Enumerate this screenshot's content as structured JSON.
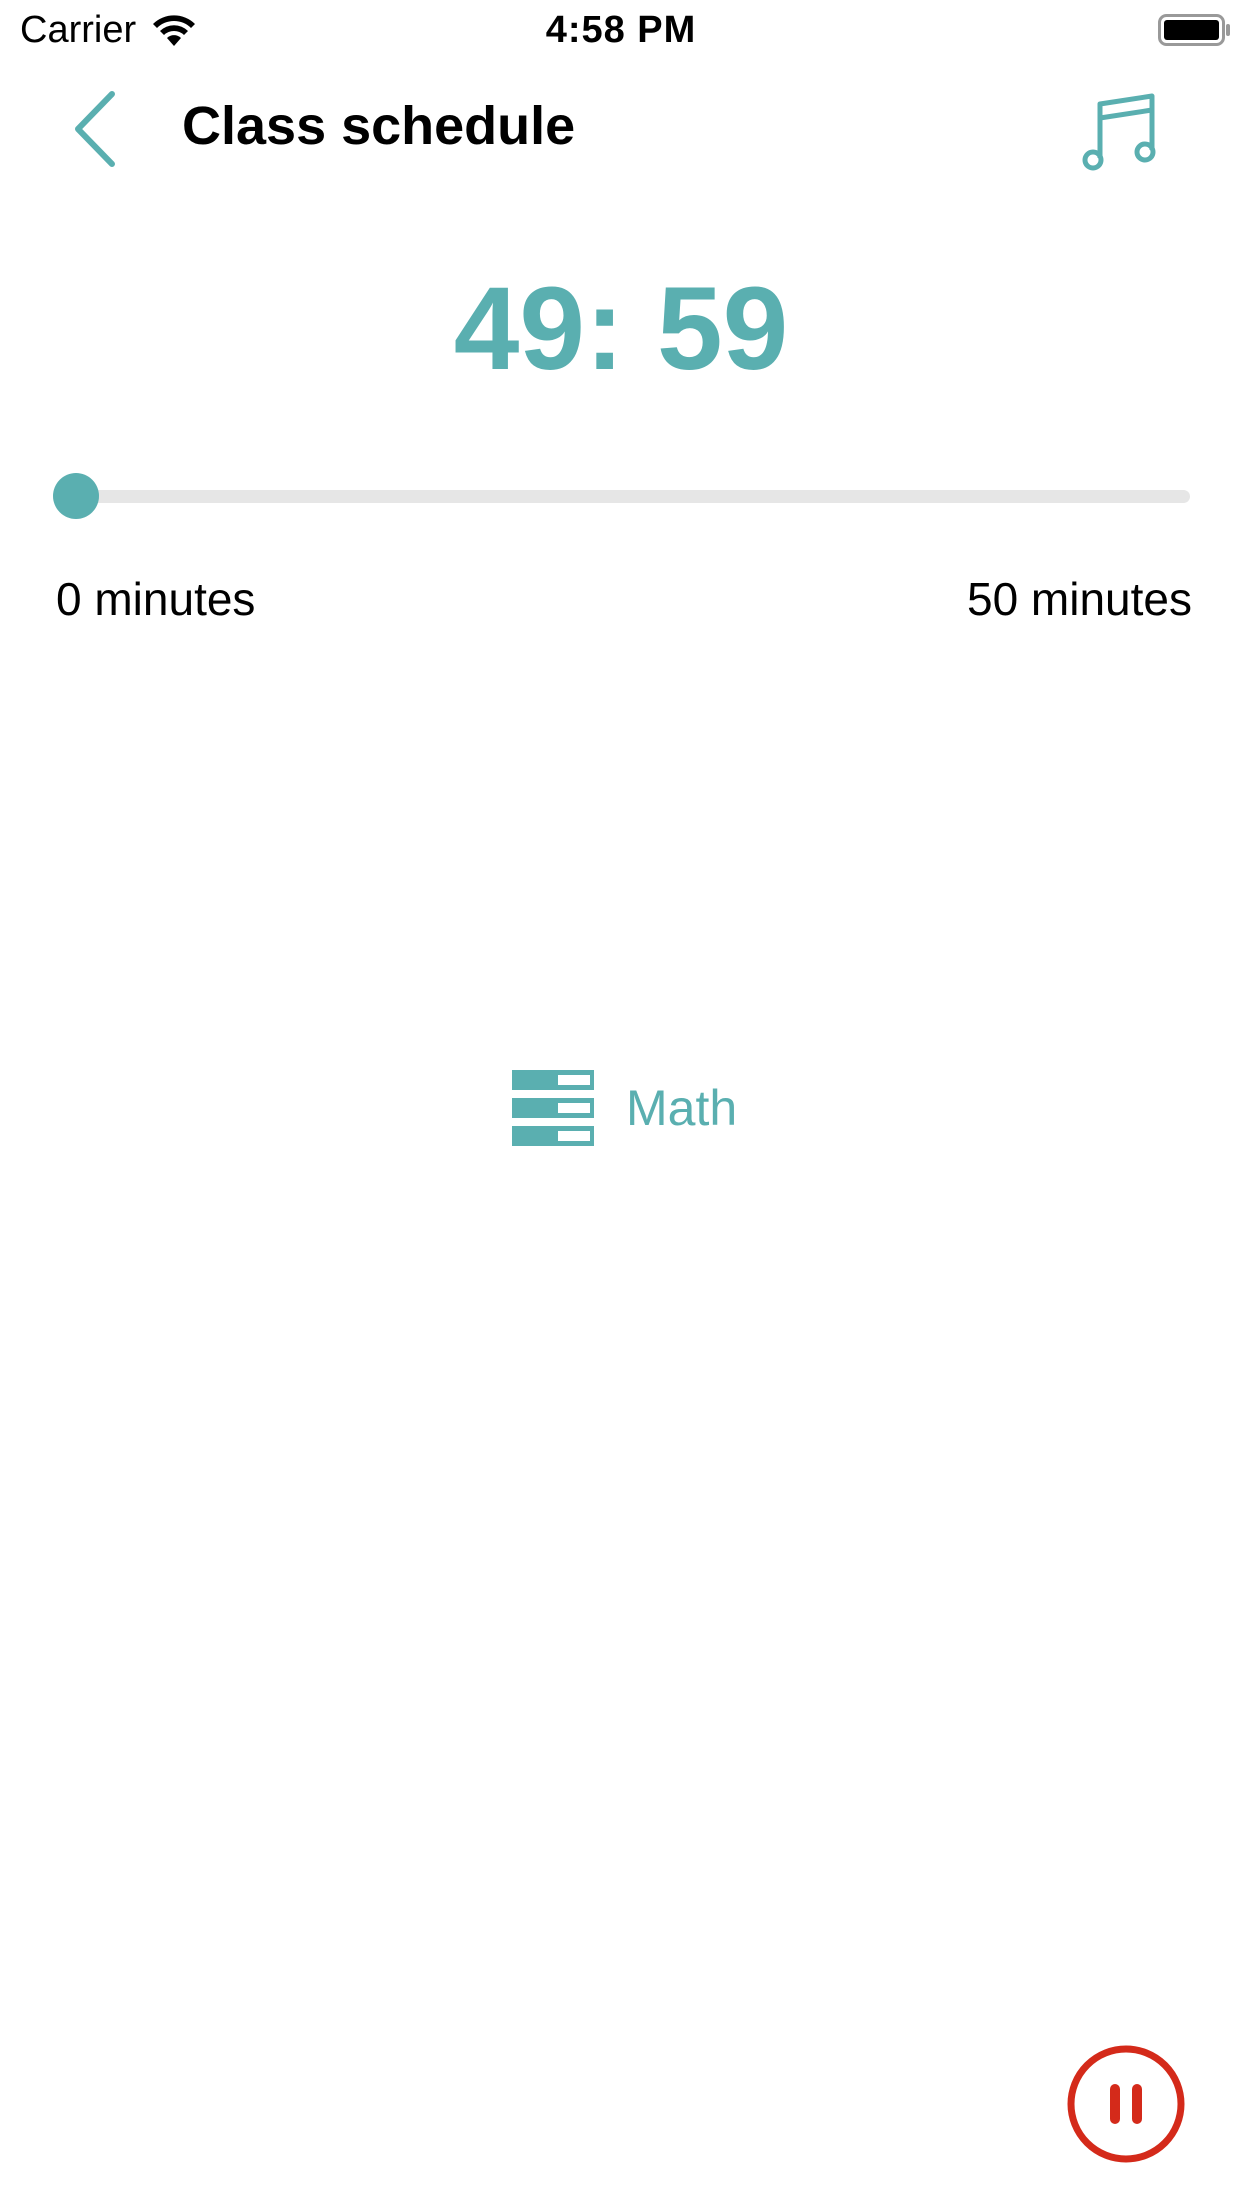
{
  "status_bar": {
    "carrier": "Carrier",
    "time": "4:58 PM",
    "wifi_icon": "wifi-icon",
    "battery_icon": "battery-icon"
  },
  "nav": {
    "back_icon": "chevron-left-icon",
    "title": "Class schedule",
    "music_icon": "music-note-icon"
  },
  "timer": {
    "value": "49: 59"
  },
  "progress": {
    "fraction": 0.0,
    "min_label": "0 minutes",
    "max_label": "50 minutes"
  },
  "subject": {
    "icon": "schedule-list-icon",
    "name": "Math"
  },
  "controls": {
    "pause_icon": "pause-icon"
  },
  "colors": {
    "accent": "#5aafb0",
    "track": "#e6e6e6",
    "pause": "#d42a1a"
  }
}
